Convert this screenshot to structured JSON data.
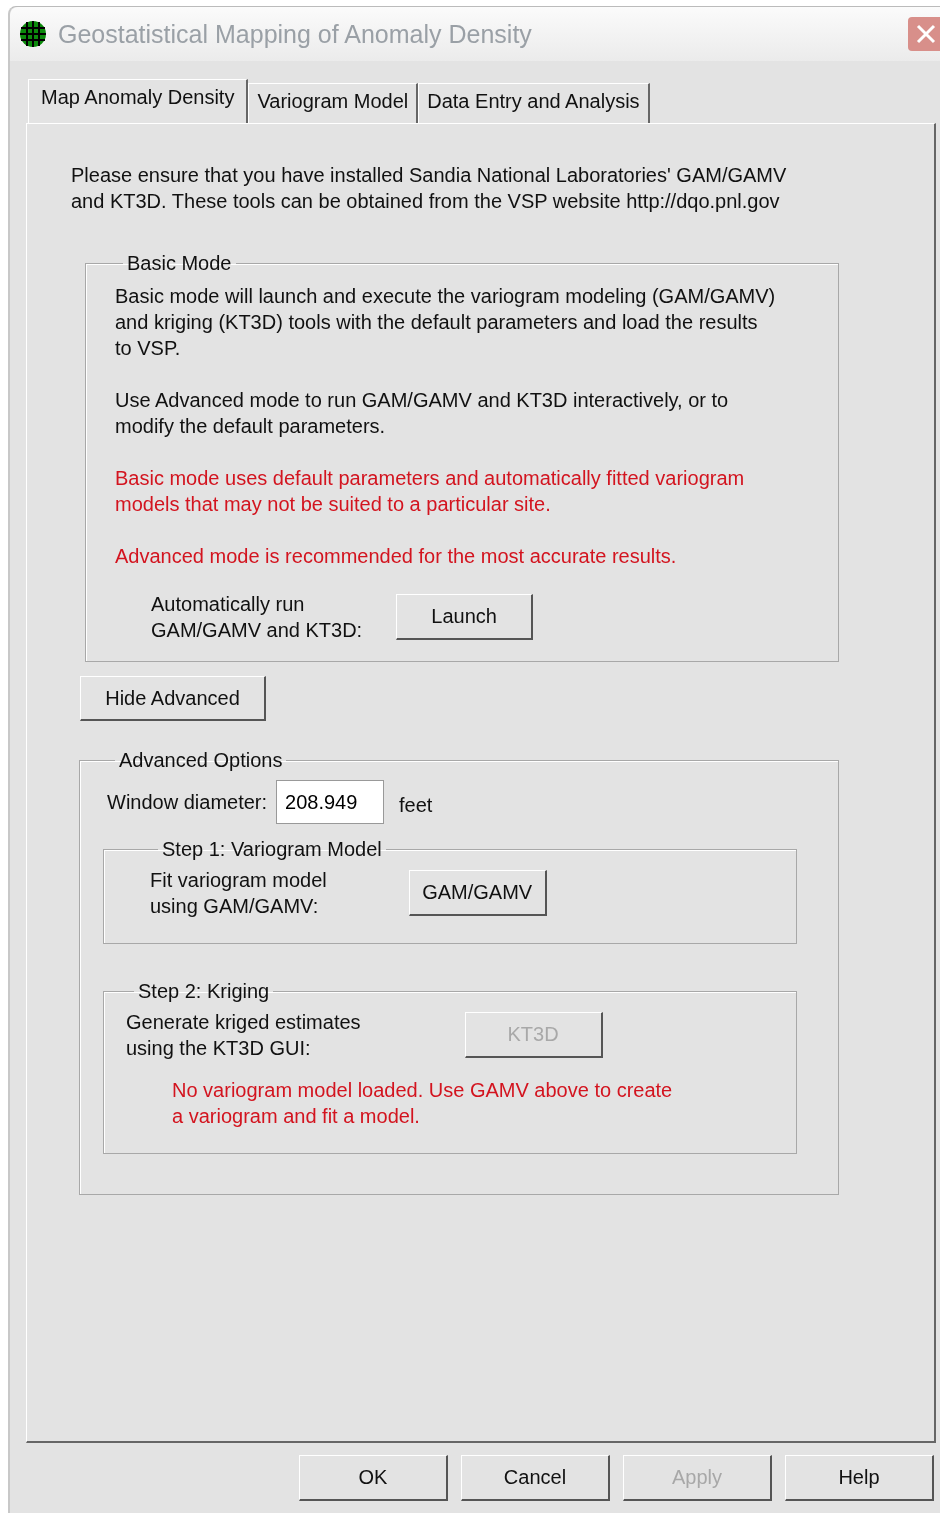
{
  "window": {
    "title": "Geostatistical Mapping of Anomaly Density"
  },
  "tabs": [
    {
      "label": "Map Anomaly Density",
      "selected": true
    },
    {
      "label": "Variogram Model",
      "selected": false
    },
    {
      "label": "Data Entry and Analysis",
      "selected": false
    }
  ],
  "intro": "Please ensure that you have installed Sandia National Laboratories' GAM/GAMV\nand KT3D.  These tools can be obtained from the VSP website http://dqo.pnl.gov",
  "basic_mode": {
    "legend": "Basic Mode",
    "paragraphs": [
      {
        "kind": "normal",
        "text": "Basic mode will launch and execute the variogram modeling (GAM/GAMV)\nand kriging (KT3D) tools with the default parameters and load the results\nto VSP."
      },
      {
        "kind": "normal",
        "text": "Use Advanced mode to run GAM/GAMV and KT3D interactively, or to\nmodify the default parameters."
      },
      {
        "kind": "warning",
        "text": "Basic mode uses default parameters and automatically fitted variogram\nmodels that may not be suited to a particular site."
      },
      {
        "kind": "warning",
        "text": "Advanced mode is recommended for the most accurate results."
      }
    ],
    "action_label": "Automatically run\nGAM/GAMV and KT3D:",
    "action_button": {
      "label": "Launch",
      "disabled": false
    }
  },
  "toggle_button": {
    "label": "Hide Advanced",
    "disabled": false
  },
  "advanced": {
    "legend": "Advanced Options",
    "diameter": {
      "label": "Window diameter:",
      "value": "208.949",
      "unit": "feet"
    },
    "steps": [
      {
        "legend": "Step 1: Variogram Model",
        "label": "Fit variogram model\nusing GAM/GAMV:",
        "button": {
          "label": "GAM/GAMV",
          "disabled": false
        }
      },
      {
        "legend": "Step 2: Kriging",
        "label": "Generate kriged estimates\nusing the KT3D GUI:",
        "button": {
          "label": "KT3D",
          "disabled": true
        },
        "warning": "No variogram model loaded.  Use GAMV above to create\na variogram and fit a model."
      }
    ]
  },
  "buttons": [
    {
      "label": "OK",
      "disabled": false
    },
    {
      "label": "Cancel",
      "disabled": false
    },
    {
      "label": "Apply",
      "disabled": true
    },
    {
      "label": "Help",
      "disabled": false
    }
  ]
}
